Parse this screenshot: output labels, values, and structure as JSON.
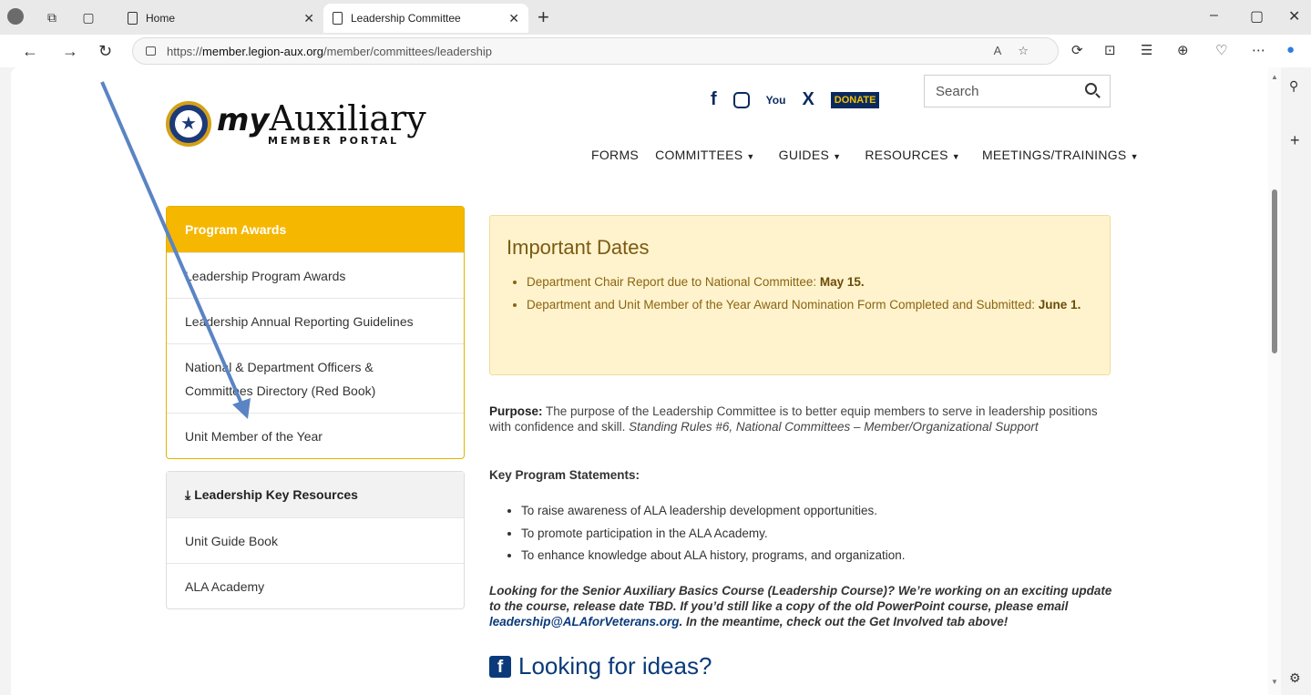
{
  "browser": {
    "tabs": [
      {
        "label": "Home"
      },
      {
        "label": "Leadership Committee"
      }
    ],
    "url_prefix": "https://",
    "url_host": "member.legion-aux.org",
    "url_path": "/member/committees/leadership"
  },
  "header": {
    "logo_my": "my",
    "logo_main": "Auxiliary",
    "logo_sub": "MEMBER PORTAL",
    "donate": "DONATE",
    "search_placeholder": "Search",
    "social": {
      "x": "X",
      "facebook": "f",
      "youtube": "You"
    },
    "nav": [
      {
        "label": "FORMS"
      },
      {
        "label": "COMMITTEES"
      },
      {
        "label": "GUIDES"
      },
      {
        "label": "RESOURCES"
      },
      {
        "label": "MEETINGS/TRAININGS"
      }
    ]
  },
  "sidebar": {
    "awards_title": "Program Awards",
    "awards_items": [
      {
        "label": "Leadership Program Awards"
      },
      {
        "label": "Leadership Annual Reporting Guidelines"
      },
      {
        "label": "National & Department Officers & Committees Directory (Red Book)"
      },
      {
        "label": "Unit Member of the Year"
      }
    ],
    "resources_title": "Leadership Key Resources",
    "resources_items": [
      {
        "label": "Unit Guide Book"
      },
      {
        "label": "ALA Academy"
      }
    ]
  },
  "main": {
    "dates_title": "Important Dates",
    "date1_text": "Department Chair Report due to National Committee: ",
    "date1_bold": "May 15.",
    "date2_text": "Department and Unit Member of the Year Award Nomination Form Completed and Submitted: ",
    "date2_bold": "June 1.",
    "purpose_label": "Purpose:",
    "purpose_text": " The purpose of the Leadership Committee is to better equip members to serve in leadership positions with confidence and skill. ",
    "purpose_italic": "Standing Rules #6, National Committees – Member/Organizational Support",
    "kps_title": "Key Program Statements:",
    "kps_items": [
      {
        "label": "To raise awareness of ALA leadership development opportunities."
      },
      {
        "label": "To promote participation in the ALA Academy."
      },
      {
        "label": "To enhance knowledge about ALA history, programs, and organization."
      }
    ],
    "looking_text1": "Looking for the Senior Auxiliary Basics Course (Leadership Course)? We’re working on an exciting update to the course, release date TBD. If you’d still like a copy of the old PowerPoint course, please email ",
    "looking_email": "leadership@ALAforVeterans.org",
    "looking_text2": ". In the meantime, check out the Get Involved tab above!",
    "ideas_title": "Looking for ideas?"
  }
}
